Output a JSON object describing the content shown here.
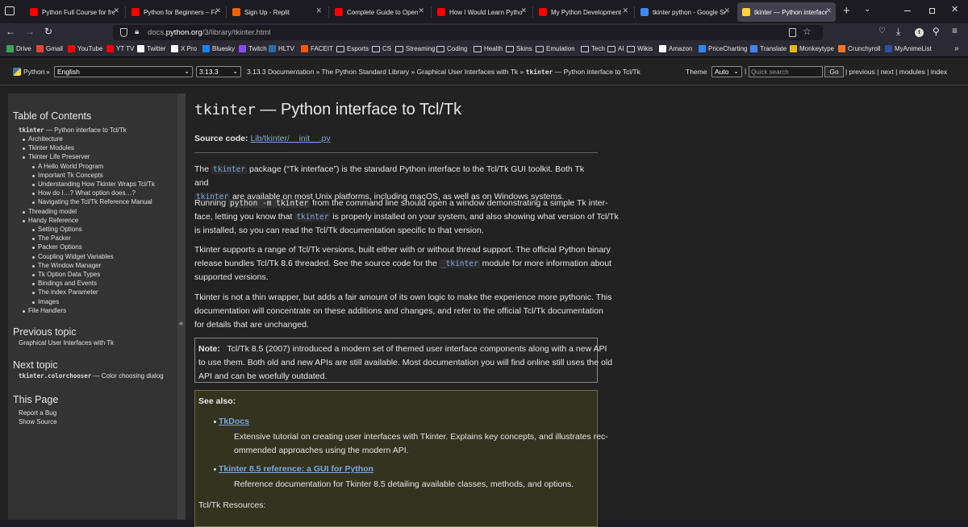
{
  "tabs": [
    {
      "title": "Python Full Course for free",
      "favicon_color": "#ff0000"
    },
    {
      "title": "Python for Beginners – Full",
      "favicon_color": "#ff0000"
    },
    {
      "title": "Sign Up - Replit",
      "favicon_color": "#f26207"
    },
    {
      "title": "Complete Guide to Open S",
      "favicon_color": "#ff0000"
    },
    {
      "title": "How I Would Learn Python",
      "favicon_color": "#ff0000"
    },
    {
      "title": "My Python Development E",
      "favicon_color": "#ff0000"
    },
    {
      "title": "tkinter python - Google Se",
      "favicon_color": "#4285f4"
    },
    {
      "title": "tkinter — Python interface",
      "favicon_color": "#ffd43b"
    }
  ],
  "url": {
    "prefix": "docs.",
    "domain": "python.org",
    "path": "/3/library/tkinter.html"
  },
  "bookmarks": [
    {
      "label": "Drive",
      "icon": "drive-icon",
      "color": "#34a853"
    },
    {
      "label": "Gmail",
      "icon": "gmail-icon",
      "color": "#ea4335"
    },
    {
      "label": "YouTube",
      "icon": "youtube-icon",
      "color": "#ff0000"
    },
    {
      "label": "YT TV",
      "icon": "youtube-icon",
      "color": "#ff0000"
    },
    {
      "label": "Twitter",
      "icon": "x-icon",
      "color": "#ffffff"
    },
    {
      "label": "X Pro",
      "icon": "x-icon",
      "color": "#ffffff"
    },
    {
      "label": "Bluesky",
      "icon": "bluesky-icon",
      "color": "#1185fe"
    },
    {
      "label": "Twitch",
      "icon": "twitch-icon",
      "color": "#9146ff"
    },
    {
      "label": "HLTV",
      "icon": "hltv-icon",
      "color": "#2d6da3"
    },
    {
      "label": "FACEIT",
      "icon": "faceit-icon",
      "color": "#ff5500"
    },
    {
      "label": "Esports",
      "icon": "folder-icon",
      "color": ""
    },
    {
      "label": "CS",
      "icon": "folder-icon",
      "color": ""
    },
    {
      "label": "Streaming",
      "icon": "folder-icon",
      "color": ""
    },
    {
      "label": "Coding",
      "icon": "folder-icon",
      "color": ""
    },
    {
      "label": "Health",
      "icon": "folder-icon",
      "color": ""
    },
    {
      "label": "Skins",
      "icon": "folder-icon",
      "color": ""
    },
    {
      "label": "Emulation",
      "icon": "folder-icon",
      "color": ""
    },
    {
      "label": "Tech",
      "icon": "folder-icon",
      "color": ""
    },
    {
      "label": "AI",
      "icon": "folder-icon",
      "color": ""
    },
    {
      "label": "Wikis",
      "icon": "folder-icon",
      "color": ""
    },
    {
      "label": "Amazon",
      "icon": "amazon-icon",
      "color": "#ffffff"
    },
    {
      "label": "PriceCharting",
      "icon": "pricecharting-icon",
      "color": "#2a8af6"
    },
    {
      "label": "Translate",
      "icon": "translate-icon",
      "color": "#4285f4"
    },
    {
      "label": "Monkeytype",
      "icon": "monkeytype-icon",
      "color": "#e2b714"
    },
    {
      "label": "Crunchyroll",
      "icon": "crunchyroll-icon",
      "color": "#f47521"
    },
    {
      "label": "MyAnimeList",
      "icon": "myanimelist-icon",
      "color": "#2e51a2"
    }
  ],
  "related": {
    "home": "Python",
    "sep": "»",
    "language": "English",
    "version": "3.13.3",
    "crumb_docs": "3.13.3 Documentation",
    "crumb_lib": "The Python Standard Library",
    "crumb_gui": "Graphical User Interfaces with Tk",
    "crumb_current_code": "tkinter",
    "crumb_current_text": "— Python interface to Tcl/Tk",
    "theme_label": "Theme",
    "theme_value": "Auto",
    "search_placeholder": "Quick search",
    "go": "Go",
    "previous": "previous",
    "next": "next",
    "modules": "modules",
    "index": "index",
    "bar": "|"
  },
  "sidebar": {
    "toc_title": "Table of Contents",
    "toc_top_code": "tkinter",
    "toc_top_text": "— Python interface to Tcl/Tk",
    "items": [
      {
        "label": "Architecture",
        "level": 1
      },
      {
        "label": "Tkinter Modules",
        "level": 1
      },
      {
        "label": "Tkinter Life Preserver",
        "level": 1
      },
      {
        "label": "A Hello World Program",
        "level": 2
      },
      {
        "label": "Important Tk Concepts",
        "level": 2
      },
      {
        "label": "Understanding How Tkinter Wraps Tcl/Tk",
        "level": 2
      },
      {
        "label": "How do I…? What option does…?",
        "level": 2
      },
      {
        "label": "Navigating the Tcl/Tk Reference Manual",
        "level": 2
      },
      {
        "label": "Threading model",
        "level": 1
      },
      {
        "label": "Handy Reference",
        "level": 1
      },
      {
        "label": "Setting Options",
        "level": 2
      },
      {
        "label": "The Packer",
        "level": 2
      },
      {
        "label": "Packer Options",
        "level": 2
      },
      {
        "label": "Coupling Widget Variables",
        "level": 2
      },
      {
        "label": "The Window Manager",
        "level": 2
      },
      {
        "label": "Tk Option Data Types",
        "level": 2
      },
      {
        "label": "Bindings and Events",
        "level": 2
      },
      {
        "label": "The index Parameter",
        "level": 2
      },
      {
        "label": "Images",
        "level": 2
      },
      {
        "label": "File Handlers",
        "level": 1
      }
    ],
    "prev_title": "Previous topic",
    "prev_link": "Graphical User Interfaces with Tk",
    "next_title": "Next topic",
    "next_code": "tkinter.colorchooser",
    "next_text": "— Color choosing dialog",
    "this_page_title": "This Page",
    "report_bug": "Report a Bug",
    "show_source": "Show Source",
    "collapse": "«"
  },
  "content": {
    "title_code": "tkinter",
    "title_text": "— Python interface to Tcl/Tk",
    "source_label": "Source code:",
    "source_link": "Lib/tkinter/__init__.py",
    "p1": [
      "The ",
      "tkinter",
      " package (“Tk interface”) is the standard Python interface to the Tcl/Tk GUI toolkit. Both Tk and",
      "tkinter",
      " are available on most Unix platforms, including macOS, as well as on Windows systems."
    ],
    "p2": [
      "Running ",
      "python -m tkinter",
      " from the command line should open a window demonstrating a simple Tk inter-",
      "face, letting you know that ",
      "tkinter",
      " is properly installed on your system, and also showing what version of Tcl/Tk",
      "is installed, so you can read the Tcl/Tk documentation specific to that version."
    ],
    "p3": [
      "Tkinter supports a range of Tcl/Tk versions, built either with or without thread support. The official Python binary",
      "release bundles Tcl/Tk 8.6 threaded. See the source code for the ",
      "_tkinter",
      " module for more information about",
      "supported versions."
    ],
    "p4": [
      "Tkinter is not a thin wrapper, but adds a fair amount of its own logic to make the experience more pythonic. This",
      "documentation will concentrate on these additions and changes, and refer to the official Tcl/Tk documentation",
      "for details that are unchanged."
    ],
    "note_label": "Note:",
    "note": [
      "Tcl/Tk 8.5 (2007) introduced a modern set of themed user interface components along with a new API",
      "to use them. Both old and new APIs are still available. Most documentation you will find online still uses the old",
      "API and can be woefully outdated."
    ],
    "seealso_label": "See also:",
    "seealso": [
      {
        "link": "TkDocs",
        "desc": [
          "Extensive tutorial on creating user interfaces with Tkinter. Explains key concepts, and illustrates rec-",
          "ommended approaches using the modern API."
        ]
      },
      {
        "link": "Tkinter 8.5 reference: a GUI for Python",
        "desc": [
          "Reference documentation for Tkinter 8.5 detailing available classes, methods, and options."
        ]
      }
    ],
    "resources": "Tcl/Tk Resources:"
  },
  "colors": {
    "link": "#7aa6e0",
    "seealso_bg": "#33331f",
    "seealso_border": "#6e6e42"
  }
}
